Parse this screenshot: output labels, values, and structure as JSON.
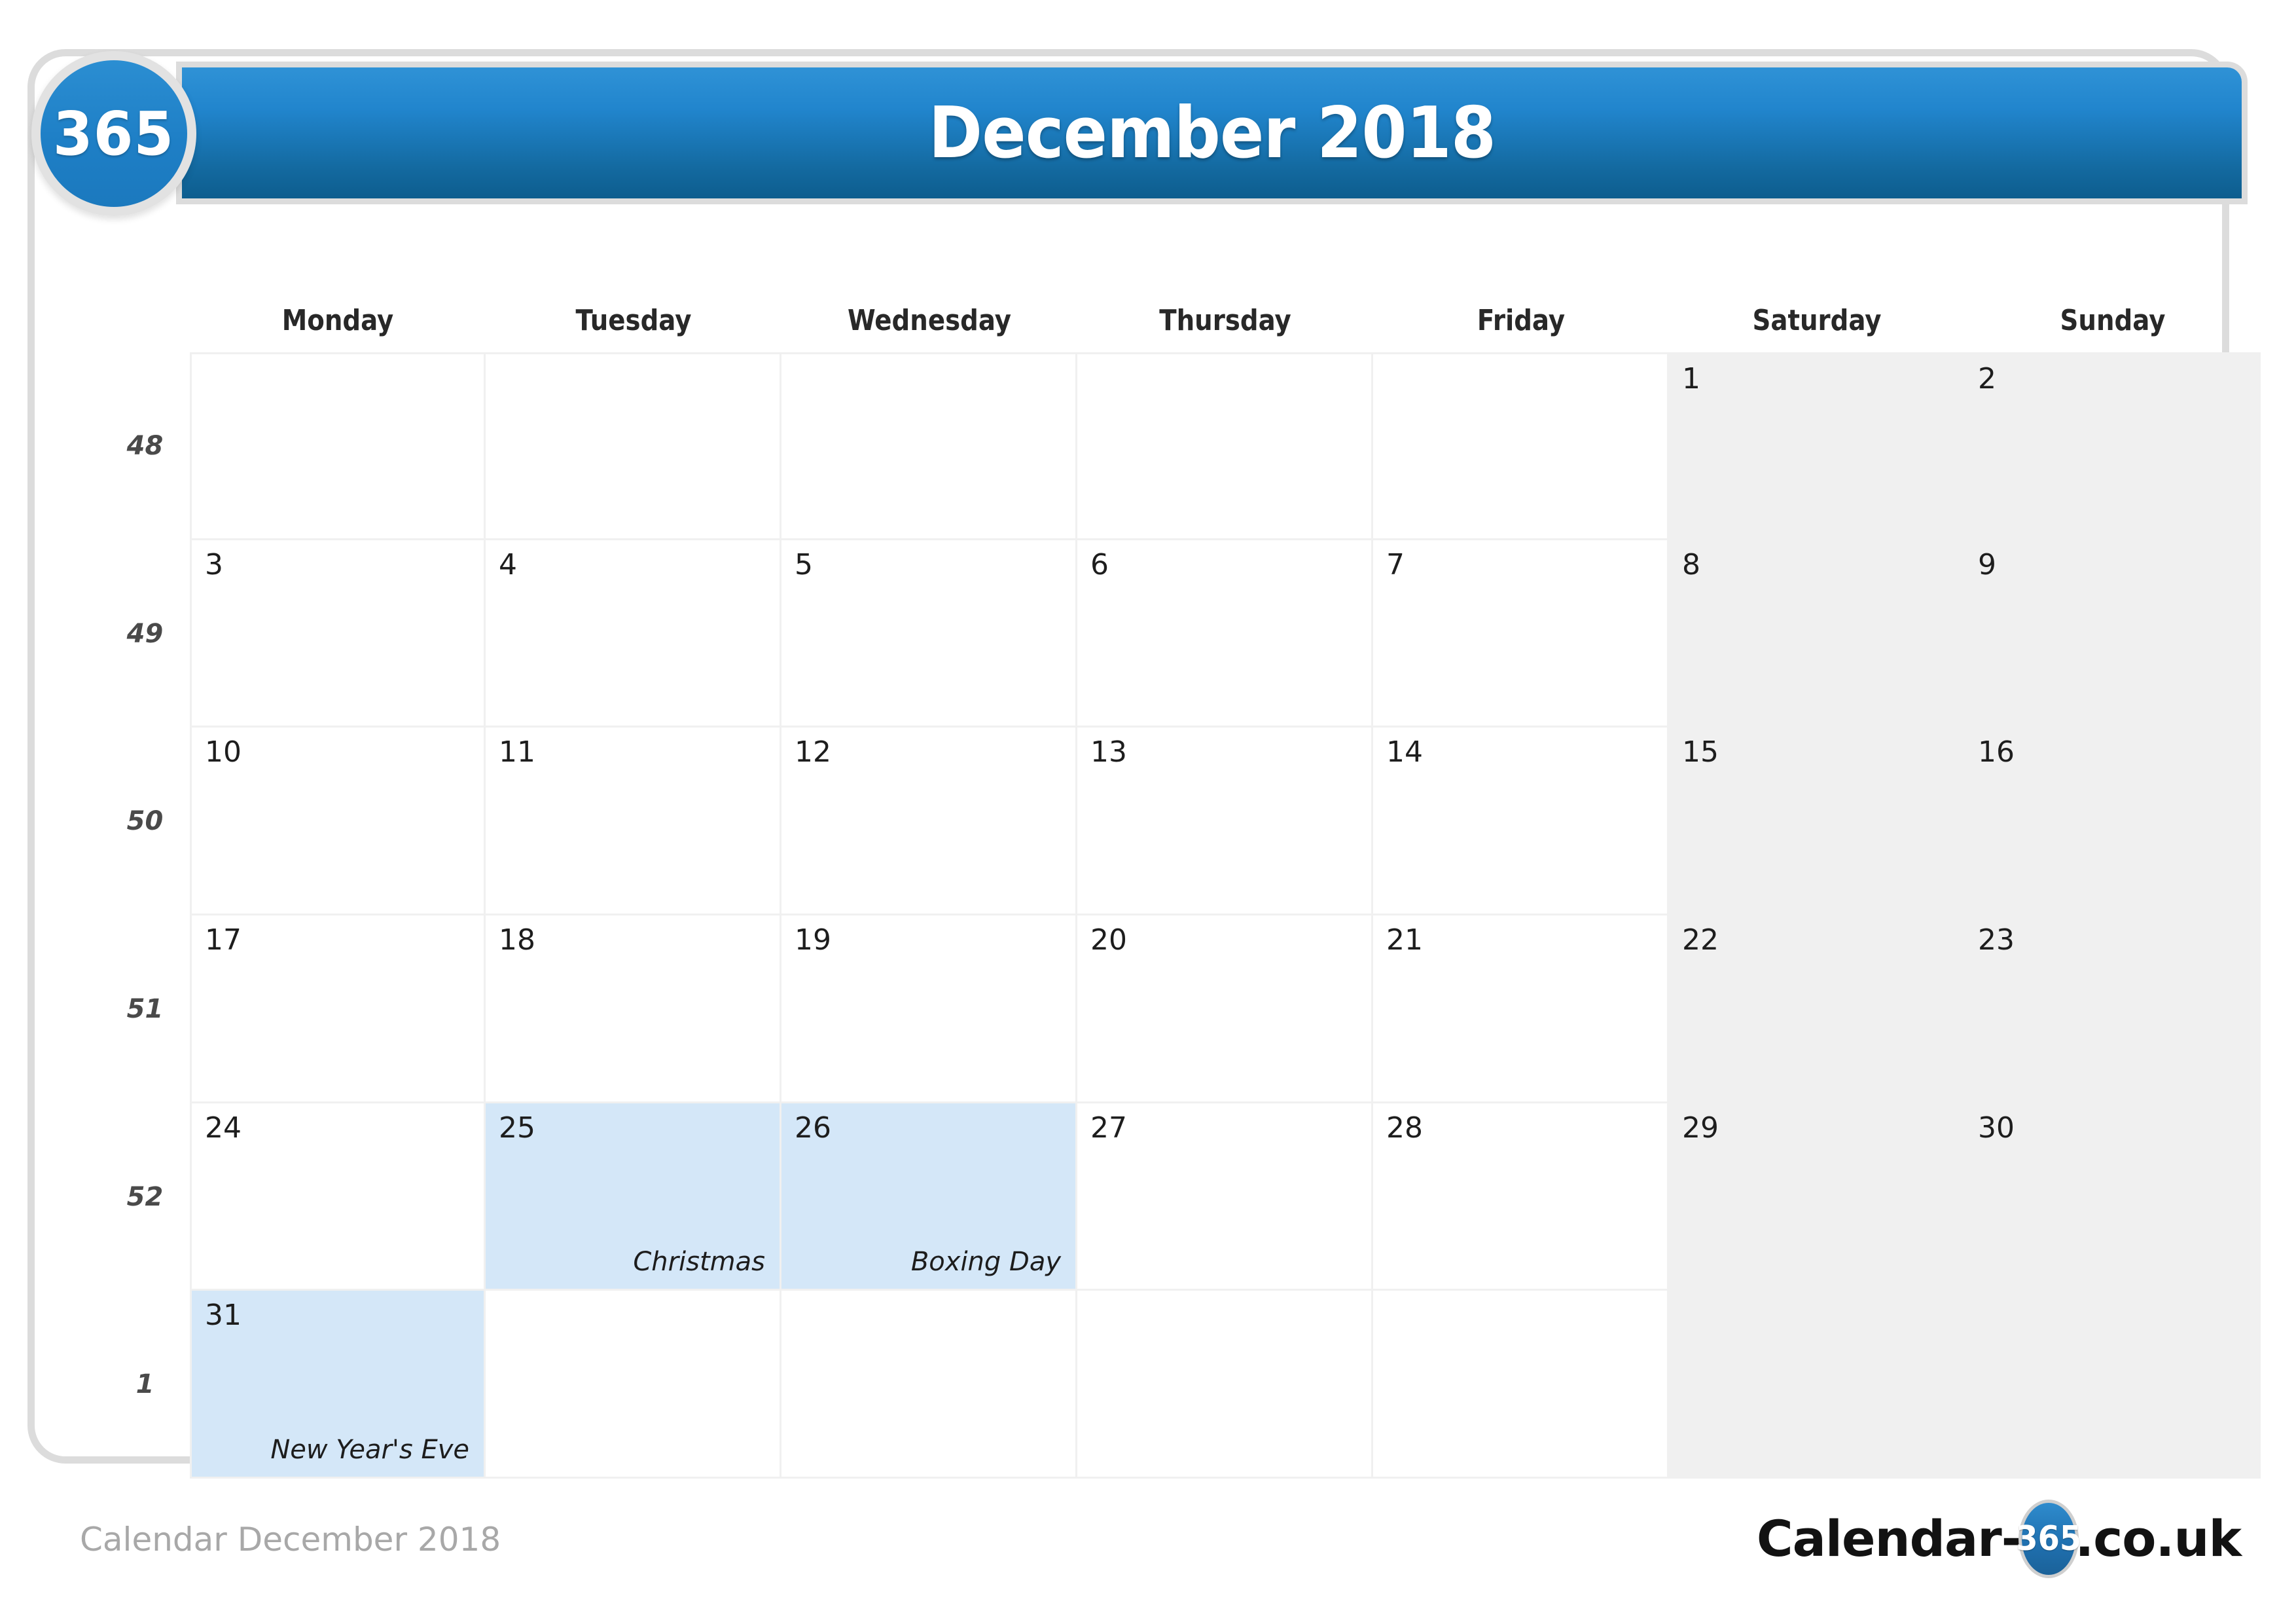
{
  "brand": {
    "badge_text": "365",
    "accent_color": "#1f7fc4",
    "frame_color": "#dcdcdc"
  },
  "header": {
    "title": "December 2018"
  },
  "weekday_headers": [
    "Monday",
    "Tuesday",
    "Wednesday",
    "Thursday",
    "Friday",
    "Saturday",
    "Sunday"
  ],
  "week_numbers": [
    "48",
    "49",
    "50",
    "51",
    "52",
    "1"
  ],
  "colors": {
    "weekend_bg": "#f0f0f0",
    "holiday_bg": "#d4e7f8",
    "grid_line": "#f0f0f0"
  },
  "weeks": [
    {
      "week_number": "48",
      "days": [
        {
          "number": "",
          "event": "",
          "weekend": false,
          "holiday": false,
          "blank": true
        },
        {
          "number": "",
          "event": "",
          "weekend": false,
          "holiday": false,
          "blank": true
        },
        {
          "number": "",
          "event": "",
          "weekend": false,
          "holiday": false,
          "blank": true
        },
        {
          "number": "",
          "event": "",
          "weekend": false,
          "holiday": false,
          "blank": true
        },
        {
          "number": "",
          "event": "",
          "weekend": false,
          "holiday": false,
          "blank": true
        },
        {
          "number": "1",
          "event": "",
          "weekend": true,
          "holiday": false,
          "blank": false
        },
        {
          "number": "2",
          "event": "",
          "weekend": true,
          "holiday": false,
          "blank": false
        }
      ]
    },
    {
      "week_number": "49",
      "days": [
        {
          "number": "3",
          "event": "",
          "weekend": false,
          "holiday": false,
          "blank": false
        },
        {
          "number": "4",
          "event": "",
          "weekend": false,
          "holiday": false,
          "blank": false
        },
        {
          "number": "5",
          "event": "",
          "weekend": false,
          "holiday": false,
          "blank": false
        },
        {
          "number": "6",
          "event": "",
          "weekend": false,
          "holiday": false,
          "blank": false
        },
        {
          "number": "7",
          "event": "",
          "weekend": false,
          "holiday": false,
          "blank": false
        },
        {
          "number": "8",
          "event": "",
          "weekend": true,
          "holiday": false,
          "blank": false
        },
        {
          "number": "9",
          "event": "",
          "weekend": true,
          "holiday": false,
          "blank": false
        }
      ]
    },
    {
      "week_number": "50",
      "days": [
        {
          "number": "10",
          "event": "",
          "weekend": false,
          "holiday": false,
          "blank": false
        },
        {
          "number": "11",
          "event": "",
          "weekend": false,
          "holiday": false,
          "blank": false
        },
        {
          "number": "12",
          "event": "",
          "weekend": false,
          "holiday": false,
          "blank": false
        },
        {
          "number": "13",
          "event": "",
          "weekend": false,
          "holiday": false,
          "blank": false
        },
        {
          "number": "14",
          "event": "",
          "weekend": false,
          "holiday": false,
          "blank": false
        },
        {
          "number": "15",
          "event": "",
          "weekend": true,
          "holiday": false,
          "blank": false
        },
        {
          "number": "16",
          "event": "",
          "weekend": true,
          "holiday": false,
          "blank": false
        }
      ]
    },
    {
      "week_number": "51",
      "days": [
        {
          "number": "17",
          "event": "",
          "weekend": false,
          "holiday": false,
          "blank": false
        },
        {
          "number": "18",
          "event": "",
          "weekend": false,
          "holiday": false,
          "blank": false
        },
        {
          "number": "19",
          "event": "",
          "weekend": false,
          "holiday": false,
          "blank": false
        },
        {
          "number": "20",
          "event": "",
          "weekend": false,
          "holiday": false,
          "blank": false
        },
        {
          "number": "21",
          "event": "",
          "weekend": false,
          "holiday": false,
          "blank": false
        },
        {
          "number": "22",
          "event": "",
          "weekend": true,
          "holiday": false,
          "blank": false
        },
        {
          "number": "23",
          "event": "",
          "weekend": true,
          "holiday": false,
          "blank": false
        }
      ]
    },
    {
      "week_number": "52",
      "days": [
        {
          "number": "24",
          "event": "",
          "weekend": false,
          "holiday": false,
          "blank": false
        },
        {
          "number": "25",
          "event": "Christmas",
          "weekend": false,
          "holiday": true,
          "blank": false
        },
        {
          "number": "26",
          "event": "Boxing Day",
          "weekend": false,
          "holiday": true,
          "blank": false
        },
        {
          "number": "27",
          "event": "",
          "weekend": false,
          "holiday": false,
          "blank": false
        },
        {
          "number": "28",
          "event": "",
          "weekend": false,
          "holiday": false,
          "blank": false
        },
        {
          "number": "29",
          "event": "",
          "weekend": true,
          "holiday": false,
          "blank": false
        },
        {
          "number": "30",
          "event": "",
          "weekend": true,
          "holiday": false,
          "blank": false
        }
      ]
    },
    {
      "week_number": "1",
      "days": [
        {
          "number": "31",
          "event": "New Year's Eve",
          "weekend": false,
          "holiday": true,
          "blank": false
        },
        {
          "number": "",
          "event": "",
          "weekend": false,
          "holiday": false,
          "blank": true
        },
        {
          "number": "",
          "event": "",
          "weekend": false,
          "holiday": false,
          "blank": true
        },
        {
          "number": "",
          "event": "",
          "weekend": false,
          "holiday": false,
          "blank": true
        },
        {
          "number": "",
          "event": "",
          "weekend": false,
          "holiday": false,
          "blank": true
        },
        {
          "number": "",
          "event": "",
          "weekend": true,
          "holiday": false,
          "blank": true
        },
        {
          "number": "",
          "event": "",
          "weekend": true,
          "holiday": false,
          "blank": true
        }
      ]
    }
  ],
  "watermark": {
    "text": "365"
  },
  "footer": {
    "caption": "Calendar December 2018",
    "logo_prefix": "Calendar-",
    "logo_badge": "365",
    "logo_suffix": ".co.uk"
  }
}
